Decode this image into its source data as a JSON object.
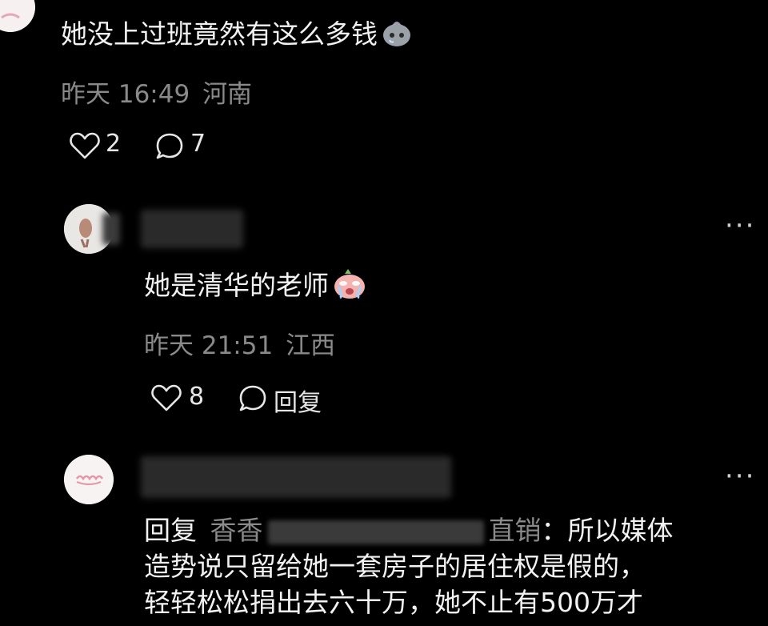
{
  "colors": {
    "background": "#000000",
    "primary_text": "#f2f2f2",
    "meta_text": "#8a8a8a"
  },
  "comment_top": {
    "text": "她没上过班竟然有这么多钱",
    "emoji": "crying-blob-emoji",
    "time": "昨天 16:49",
    "location": "河南",
    "likes": "2",
    "replies": "7"
  },
  "reply_1": {
    "text": "她是清华的老师",
    "emoji": "crying-face-emoji",
    "time": "昨天 21:51",
    "location": "江西",
    "likes": "8",
    "reply_label": "回复",
    "more": "···"
  },
  "reply_2": {
    "more": "···",
    "prefix": "回复",
    "target_start": "香香",
    "target_end": "直销",
    "line1_rest": "：所以媒体",
    "line2": "造势说只留给她一套房子的居住权是假的，",
    "line3": "轻轻松松捐出去六十万，她不止有500万才"
  }
}
